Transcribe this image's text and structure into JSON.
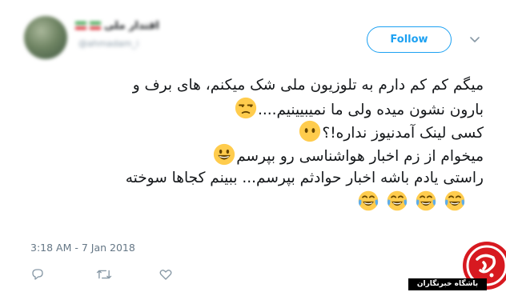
{
  "user": {
    "display_name": "اقتدار ملی",
    "handle": "@ahmadam_i"
  },
  "follow_label": "Follow",
  "menu_icon": "chevron-down-icon",
  "tweet": {
    "lines": [
      "میگم کم کم دارم به تلوزیون ملی شک میکنم، های برف و",
      "بارون نشون میده ولی ما نمیبیینیم....",
      "کسی لینک آمدنیوز نداره!؟",
      "میخوام از زم اخبار هواشناسی رو بپرسم",
      "راستی یادم باشه اخبار حوادثم بپرسم... ببینم کجاها سوخته"
    ],
    "emojis": {
      "line2": "unamused-face-emoji",
      "line3": "face-without-mouth-emoji",
      "line4": "grinning-face-emoji",
      "line6": [
        "tears-of-joy-emoji",
        "tears-of-joy-emoji",
        "tears-of-joy-emoji",
        "tears-of-joy-emoji"
      ]
    }
  },
  "timestamp": "3:18 AM - 7 Jan 2018",
  "actions": [
    "reply-icon",
    "retweet-icon",
    "like-icon"
  ],
  "watermark": {
    "label": "باشگاه خبرنگاران"
  },
  "colors": {
    "accent": "#1da1f2",
    "text": "#14171a",
    "muted": "#657786",
    "emoji": "#ffcc4d",
    "watermark": "#d71920"
  }
}
